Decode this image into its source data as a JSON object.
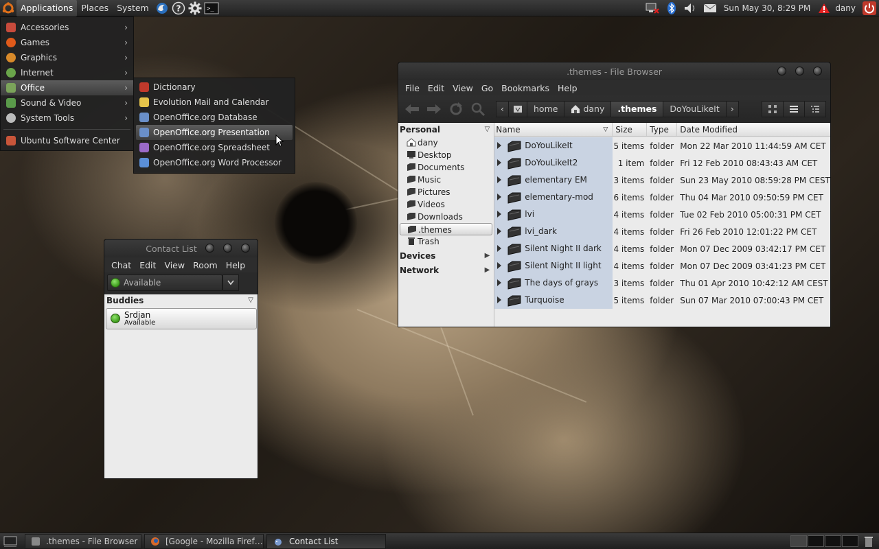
{
  "top_panel": {
    "menus": [
      "Applications",
      "Places",
      "System"
    ],
    "clock": "Sun May 30,  8:29 PM",
    "user": "dany"
  },
  "apps_menu": {
    "items": [
      {
        "label": "Accessories",
        "icon": "accessories-icon",
        "color": "#c84b3c"
      },
      {
        "label": "Games",
        "icon": "games-icon",
        "color": "#e05a1a"
      },
      {
        "label": "Graphics",
        "icon": "graphics-icon",
        "color": "#d88a2a"
      },
      {
        "label": "Internet",
        "icon": "internet-icon",
        "color": "#6aa54a"
      },
      {
        "label": "Office",
        "icon": "office-icon",
        "color": "#7ba35a"
      },
      {
        "label": "Sound & Video",
        "icon": "sound-video-icon",
        "color": "#5a9a4a"
      },
      {
        "label": "System Tools",
        "icon": "gear-icon",
        "color": "#bbbbbb"
      }
    ],
    "extra": {
      "label": "Ubuntu Software Center",
      "icon": "software-center-icon",
      "color": "#c8553a"
    }
  },
  "office_submenu": {
    "items": [
      {
        "label": "Dictionary",
        "icon": "dictionary-icon",
        "color": "#c0392b"
      },
      {
        "label": "Evolution Mail and Calendar",
        "icon": "evolution-icon",
        "color": "#e6c34a"
      },
      {
        "label": "OpenOffice.org Database",
        "icon": "oo-database-icon",
        "color": "#6a8fc8"
      },
      {
        "label": "OpenOffice.org Presentation",
        "icon": "oo-presentation-icon",
        "color": "#6a8fc8"
      },
      {
        "label": "OpenOffice.org Spreadsheet",
        "icon": "oo-spreadsheet-icon",
        "color": "#9a6ac8"
      },
      {
        "label": "OpenOffice.org Word Processor",
        "icon": "oo-writer-icon",
        "color": "#5a8fd8"
      }
    ]
  },
  "file_browser": {
    "title": ".themes - File Browser",
    "menus": [
      "File",
      "Edit",
      "View",
      "Go",
      "Bookmarks",
      "Help"
    ],
    "path": [
      "home",
      "dany",
      ".themes",
      "DoYouLikeIt"
    ],
    "columns": [
      "Name",
      "Size",
      "Type",
      "Date Modified"
    ],
    "sidebar": {
      "personal_label": "Personal",
      "places": [
        "dany",
        "Desktop",
        "Documents",
        "Music",
        "Pictures",
        "Videos",
        "Downloads",
        ".themes",
        "Trash"
      ],
      "devices_label": "Devices",
      "network_label": "Network"
    },
    "rows": [
      {
        "name": "DoYouLikeIt",
        "size": "5 items",
        "type": "folder",
        "date": "Mon 22 Mar 2010 11:44:59 AM CET"
      },
      {
        "name": "DoYouLikeIt2",
        "size": "1 item",
        "type": "folder",
        "date": "Fri 12 Feb 2010 08:43:43 AM CET"
      },
      {
        "name": "elementary EM",
        "size": "3 items",
        "type": "folder",
        "date": "Sun 23 May 2010 08:59:28 PM CEST"
      },
      {
        "name": "elementary-mod",
        "size": "6 items",
        "type": "folder",
        "date": "Thu 04 Mar 2010 09:50:59 PM CET"
      },
      {
        "name": "lvi",
        "size": "4 items",
        "type": "folder",
        "date": "Tue 02 Feb 2010 05:00:31 PM CET"
      },
      {
        "name": "lvi_dark",
        "size": "4 items",
        "type": "folder",
        "date": "Fri 26 Feb 2010 12:01:22 PM CET"
      },
      {
        "name": "Silent Night II dark",
        "size": "4 items",
        "type": "folder",
        "date": "Mon 07 Dec 2009 03:42:17 PM CET"
      },
      {
        "name": "Silent Night II light",
        "size": "4 items",
        "type": "folder",
        "date": "Mon 07 Dec 2009 03:41:23 PM CET"
      },
      {
        "name": "The days of grays",
        "size": "3 items",
        "type": "folder",
        "date": "Thu 01 Apr 2010 10:42:12 AM CEST"
      },
      {
        "name": "Turquoise",
        "size": "5 items",
        "type": "folder",
        "date": "Sun 07 Mar 2010 07:00:43 PM CET"
      }
    ]
  },
  "contact_list": {
    "title": "Contact List",
    "menus": [
      "Chat",
      "Edit",
      "View",
      "Room",
      "Help"
    ],
    "status": "Available",
    "group": "Buddies",
    "buddy": {
      "name": "Srdjan",
      "status": "Available"
    }
  },
  "taskbar": {
    "tasks": [
      {
        "label": ".themes - File Browser",
        "icon": "file-manager-icon"
      },
      {
        "label": "[Google - Mozilla Firef…",
        "icon": "firefox-icon"
      },
      {
        "label": "Contact List",
        "icon": "pidgin-icon"
      }
    ]
  },
  "colors": {
    "status_green": "#3b9a1a",
    "alert_red": "#e02020",
    "selection": "#c9d3e2"
  }
}
